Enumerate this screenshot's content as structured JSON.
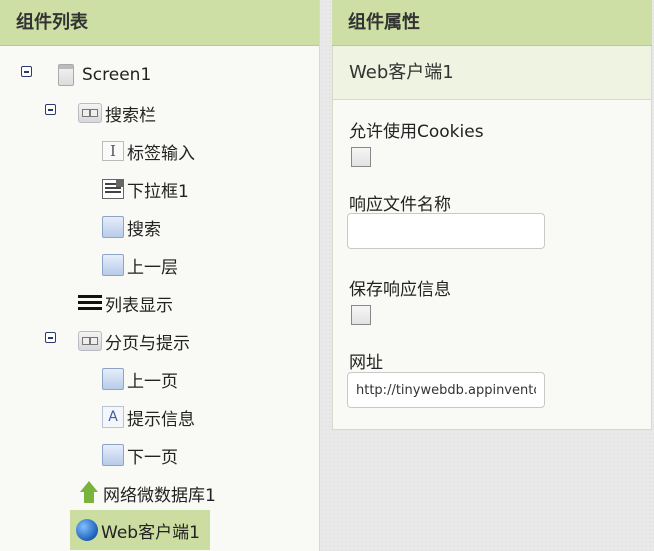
{
  "components_panel": {
    "title": "组件列表",
    "tree": [
      {
        "label": "Screen1",
        "icon": "screen-icon",
        "expanded": true
      },
      {
        "label": "搜索栏",
        "icon": "horizontal-arrangement-icon",
        "expanded": true
      },
      {
        "label": "标签输入",
        "icon": "textbox-icon"
      },
      {
        "label": "下拉框1",
        "icon": "listpicker-icon"
      },
      {
        "label": "搜索",
        "icon": "button-icon"
      },
      {
        "label": "上一层",
        "icon": "button-icon"
      },
      {
        "label": "列表显示",
        "icon": "listview-icon"
      },
      {
        "label": "分页与提示",
        "icon": "horizontal-arrangement-icon",
        "expanded": true
      },
      {
        "label": "上一页",
        "icon": "button-icon"
      },
      {
        "label": "提示信息",
        "icon": "label-icon"
      },
      {
        "label": "下一页",
        "icon": "button-icon"
      },
      {
        "label": "网络微数据库1",
        "icon": "tinywebdb-icon"
      },
      {
        "label": "Web客户端1",
        "icon": "web-icon",
        "selected": true
      }
    ]
  },
  "properties_panel": {
    "title": "组件属性",
    "component_name": "Web客户端1",
    "props": {
      "allow_cookies_label": "允许使用Cookies",
      "allow_cookies": false,
      "response_file_label": "响应文件名称",
      "response_file_value": "",
      "save_response_label": "保存响应信息",
      "save_response": false,
      "url_label": "网址",
      "url_value": "http://tinywebdb.appinventor.mit.edu"
    }
  },
  "colors": {
    "header_bg": "#cddfa5",
    "selected_bg": "#cbdda0",
    "subheader_bg": "#eef3e2"
  }
}
